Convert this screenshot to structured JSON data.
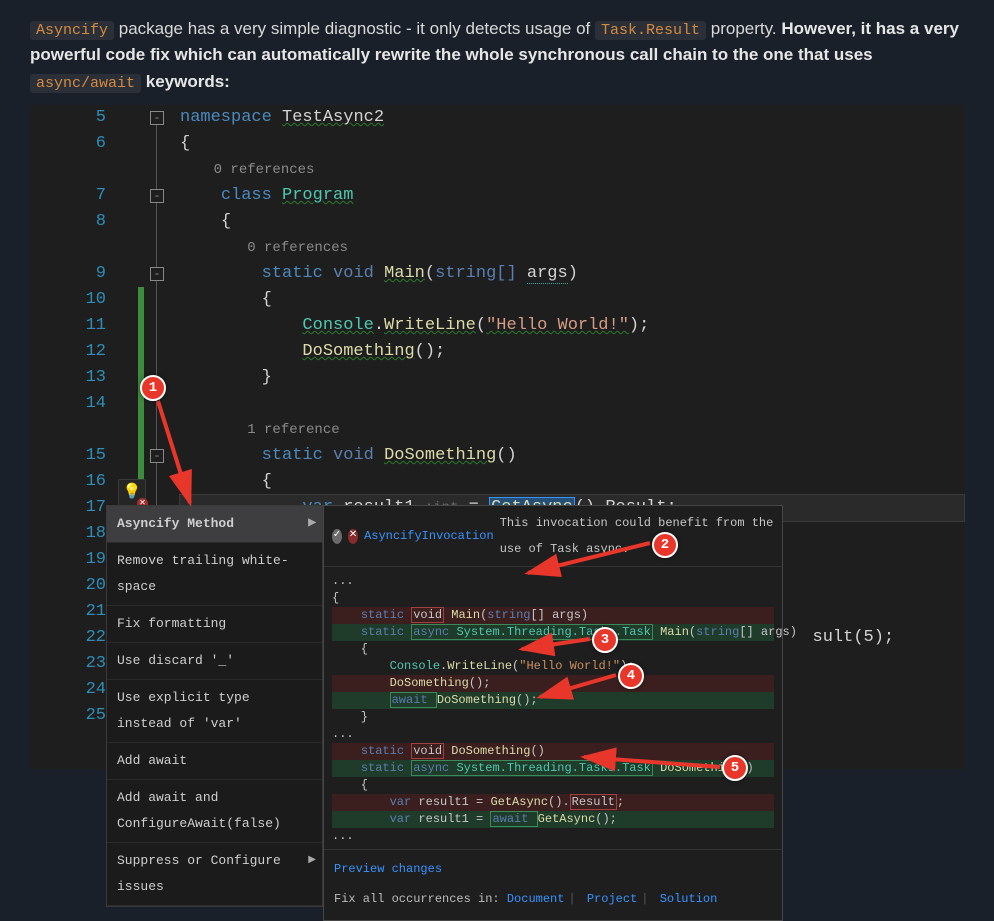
{
  "intro": {
    "pkg": "Asyncify",
    "text1": " package has a very simple diagnostic - it only detects usage of ",
    "prop": "Task.Result",
    "text2": " property. ",
    "bold": "However, it has a very powerful code fix which can automatically rewrite the whole synchronous call chain to the one that uses ",
    "kw": "async/await",
    "text3": " keywords:"
  },
  "line_numbers": [
    "5",
    "6",
    "",
    "7",
    "8",
    "",
    "9",
    "10",
    "11",
    "12",
    "13",
    "14",
    "",
    "15",
    "16",
    "17",
    "18",
    "19",
    "20",
    "21",
    "22",
    "23",
    "24",
    "25"
  ],
  "code": {
    "ns": "namespace",
    "ns_name": "TestAsync2",
    "refs0": "0 references",
    "class_kw": "class",
    "class_name": "Program",
    "static": "static",
    "void": "void",
    "main": "Main",
    "string_arr": "string[]",
    "args": "args",
    "console": "Console",
    "writeline": "WriteLine",
    "hello": "\"Hello World!\"",
    "dosomething": "DoSomething",
    "ref1": "1 reference",
    "var": "var",
    "result1": "result1",
    "inthint": ":int",
    "getasync": "GetAsync",
    "result_prop": "Result",
    "tail_line": "sult(5);"
  },
  "action_menu": {
    "items": [
      "Asyncify Method",
      "Remove trailing white-space",
      "Fix formatting",
      "Use discard '_'",
      "Use explicit type instead of 'var'",
      "Add await",
      "Add await and ConfigureAwait(false)",
      "Suppress or Configure issues"
    ]
  },
  "preview": {
    "rule_id": "AsyncifyInvocation",
    "message": "This invocation could benefit from the use of Task async.",
    "dots": "...",
    "lines": {
      "brace_o": "{",
      "main_del": "    static void Main(string[] args)",
      "main_add_pre": "    static ",
      "main_add_async": "async System.Threading.Tasks.Task",
      "main_add_post": " Main(string[] args)",
      "brace_o2": "    {",
      "cw": "        Console.WriteLine(\"Hello World!\");",
      "ds_del": "        DoSomething();",
      "ds_add_pre": "        ",
      "ds_add_await": "await ",
      "ds_add_post": "DoSomething();",
      "brace_c": "    }",
      "ds_sig_del": "    static void DoSomething()",
      "ds_sig_add_pre": "    static ",
      "ds_sig_add_post": " DoSomething()",
      "brace_o3": "    {",
      "r1_del_pre": "        var result1 = GetAsync().",
      "r1_del_res": "Result",
      "r1_del_post": ";",
      "r1_add_pre": "        var result1 = ",
      "r1_add_await": "await ",
      "r1_add_post": "GetAsync();"
    },
    "preview_changes": "Preview changes",
    "fix_all": "Fix all occurrences in:",
    "scope1": "Document",
    "scope2": "Project",
    "scope3": "Solution"
  },
  "callouts": [
    "1",
    "2",
    "3",
    "4",
    "5"
  ]
}
